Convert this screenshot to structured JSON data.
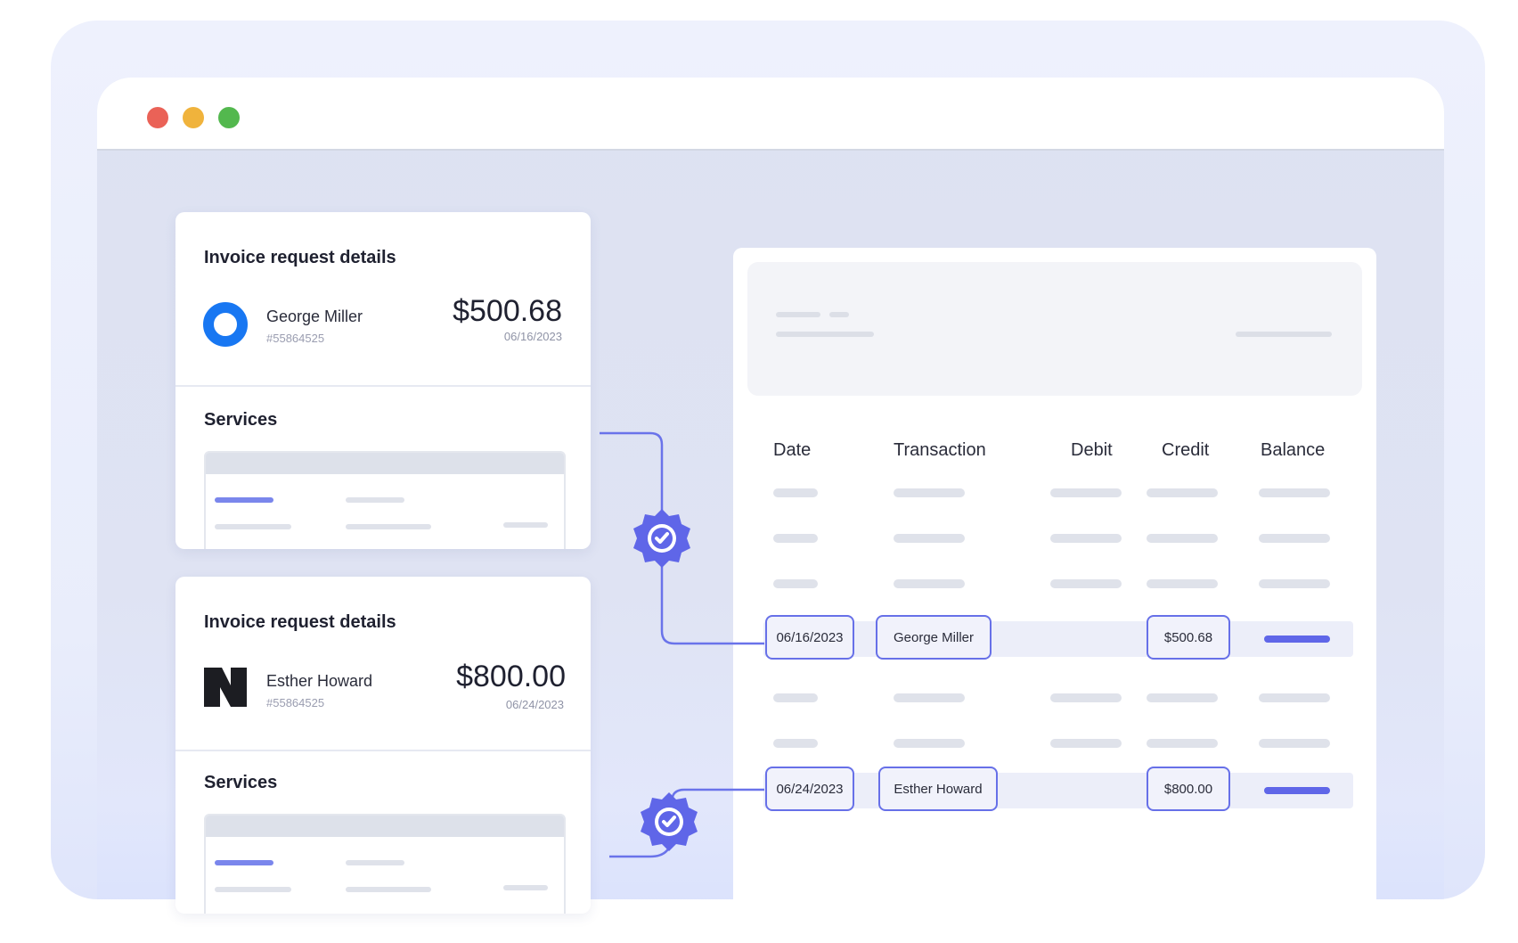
{
  "colors": {
    "accent": "#5f66e8",
    "window_controls": [
      "#ea6257",
      "#f0b33c",
      "#53b84e"
    ]
  },
  "window": {
    "controls": [
      "close",
      "minimize",
      "maximize"
    ]
  },
  "invoices": [
    {
      "title": "Invoice request details",
      "name": "George Miller",
      "ref": "#55864525",
      "amount": "$500.68",
      "date": "06/16/2023",
      "logo_icon": "blue-ring-logo-icon",
      "services_label": "Services"
    },
    {
      "title": "Invoice request details",
      "name": "Esther Howard",
      "ref": "#55864525",
      "amount": "$800.00",
      "date": "06/24/2023",
      "logo_icon": "n-logo-icon",
      "services_label": "Services"
    }
  ],
  "ledger": {
    "columns": [
      "Date",
      "Transaction",
      "Debit",
      "Credit",
      "Balance"
    ],
    "matched_rows": [
      {
        "date": "06/16/2023",
        "transaction": "George Miller",
        "credit": "$500.68"
      },
      {
        "date": "06/24/2023",
        "transaction": "Esther Howard",
        "credit": "$800.00"
      }
    ]
  },
  "icons": {
    "match": "check-badge-icon"
  }
}
